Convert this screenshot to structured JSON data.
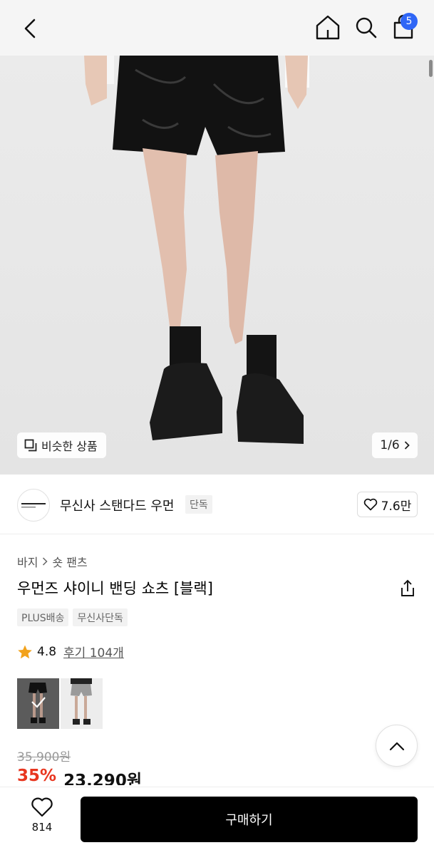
{
  "header": {
    "cart_count": "5",
    "icons": [
      "chevron-left-icon",
      "home-icon",
      "search-icon",
      "shopping-bag-icon"
    ]
  },
  "hero": {
    "similar_label": "비슷한 상품",
    "page_indicator": "1/6"
  },
  "brand": {
    "name": "무신사 스탠다드 우먼",
    "tag": "단독",
    "likes": "7.6만"
  },
  "product": {
    "breadcrumb": [
      "바지",
      "숏 팬츠"
    ],
    "title": "우먼즈 샤이니 밴딩 쇼츠 [블랙]",
    "tags": [
      "PLUS배송",
      "무신사단독"
    ],
    "rating": "4.8",
    "reviews": "후기 104개",
    "original_price": "35,900원",
    "discount": "35%",
    "sale_price": "23,290원"
  },
  "bottom": {
    "wish_count": "814",
    "buy_label": "구매하기"
  },
  "colors": {
    "accent_blue": "#2f66f6",
    "discount_red": "#e8361f",
    "star_gold": "#f2a21b",
    "button_black": "#000000"
  }
}
